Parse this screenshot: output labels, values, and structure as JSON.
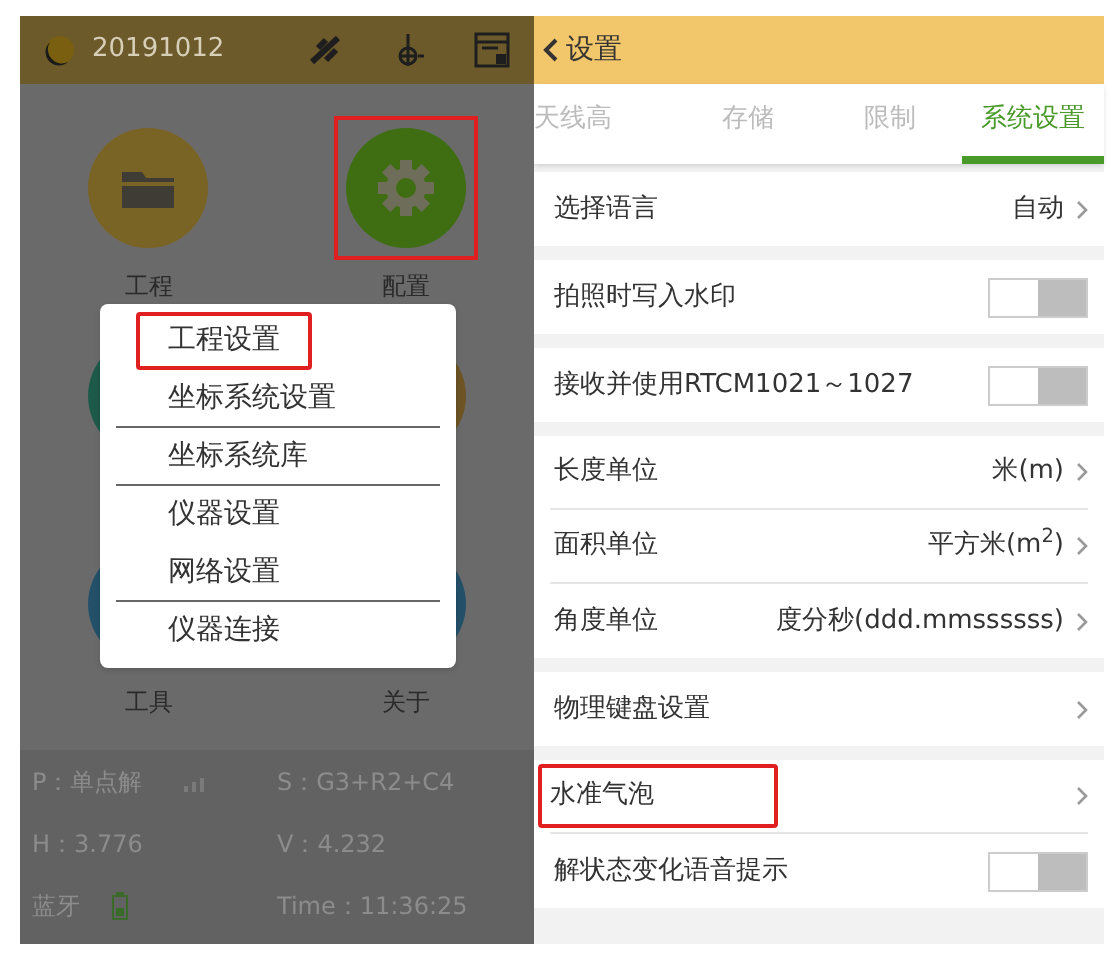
{
  "left_screen": {
    "status_bar": {
      "date": "20191012"
    },
    "apps": [
      {
        "kind": "folder",
        "label": "工程",
        "highlighted": false
      },
      {
        "kind": "gear",
        "label": "配置",
        "highlighted": true
      },
      {
        "kind": "teal"
      },
      {
        "kind": "brown"
      },
      {
        "kind": "blue",
        "label": "工具"
      },
      {
        "kind": "blue",
        "label": "关于"
      }
    ],
    "menu": [
      {
        "label": "工程设置",
        "highlighted": true,
        "separator_after": false
      },
      {
        "label": "坐标系统设置",
        "highlighted": false,
        "separator_after": true
      },
      {
        "label": "坐标系统库",
        "highlighted": false,
        "separator_after": true
      },
      {
        "label": "仪器设置",
        "highlighted": false,
        "separator_after": false
      },
      {
        "label": "网络设置",
        "highlighted": false,
        "separator_after": true
      },
      {
        "label": "仪器连接",
        "highlighted": false,
        "separator_after": false
      }
    ],
    "info": [
      {
        "text": "P：单点解",
        "kind": "signal"
      },
      {
        "text": "S：G3+R2+C4"
      },
      {
        "text": "H：3.776"
      },
      {
        "text": "V：4.232"
      },
      {
        "text": "蓝牙",
        "kind": "battery"
      },
      {
        "text": "Time：11:36:25"
      }
    ]
  },
  "right_screen": {
    "header": {
      "back": "设置"
    },
    "tabs": [
      {
        "label": "天线高",
        "selected": false
      },
      {
        "label": "存储",
        "selected": false
      },
      {
        "label": "限制",
        "selected": false
      },
      {
        "label": "系统设置",
        "selected": true
      }
    ],
    "sections": [
      [
        {
          "kind": "link",
          "label": "选择语言",
          "value": "自动",
          "highlighted": false
        }
      ],
      [
        {
          "kind": "toggle",
          "label": "拍照时写入水印",
          "on": false
        }
      ],
      [
        {
          "kind": "toggle",
          "label": "接收并使用RTCM1021～1027",
          "on": false
        }
      ],
      [
        {
          "kind": "link",
          "label": "长度单位",
          "value": "米(m)",
          "highlighted": false
        },
        {
          "kind": "link",
          "label": "面积单位",
          "value": "平方米(m$^{2}$)",
          "highlighted": false
        },
        {
          "kind": "link",
          "label": "角度单位",
          "value": "度分秒(ddd.mmssssss)",
          "highlighted": false
        }
      ],
      [
        {
          "kind": "link",
          "label": "物理键盘设置",
          "highlighted": false
        }
      ],
      [
        {
          "kind": "link",
          "label": "水准气泡",
          "highlighted": true
        },
        {
          "kind": "toggle",
          "label": "解状态变化语音提示",
          "on": false
        }
      ]
    ]
  }
}
